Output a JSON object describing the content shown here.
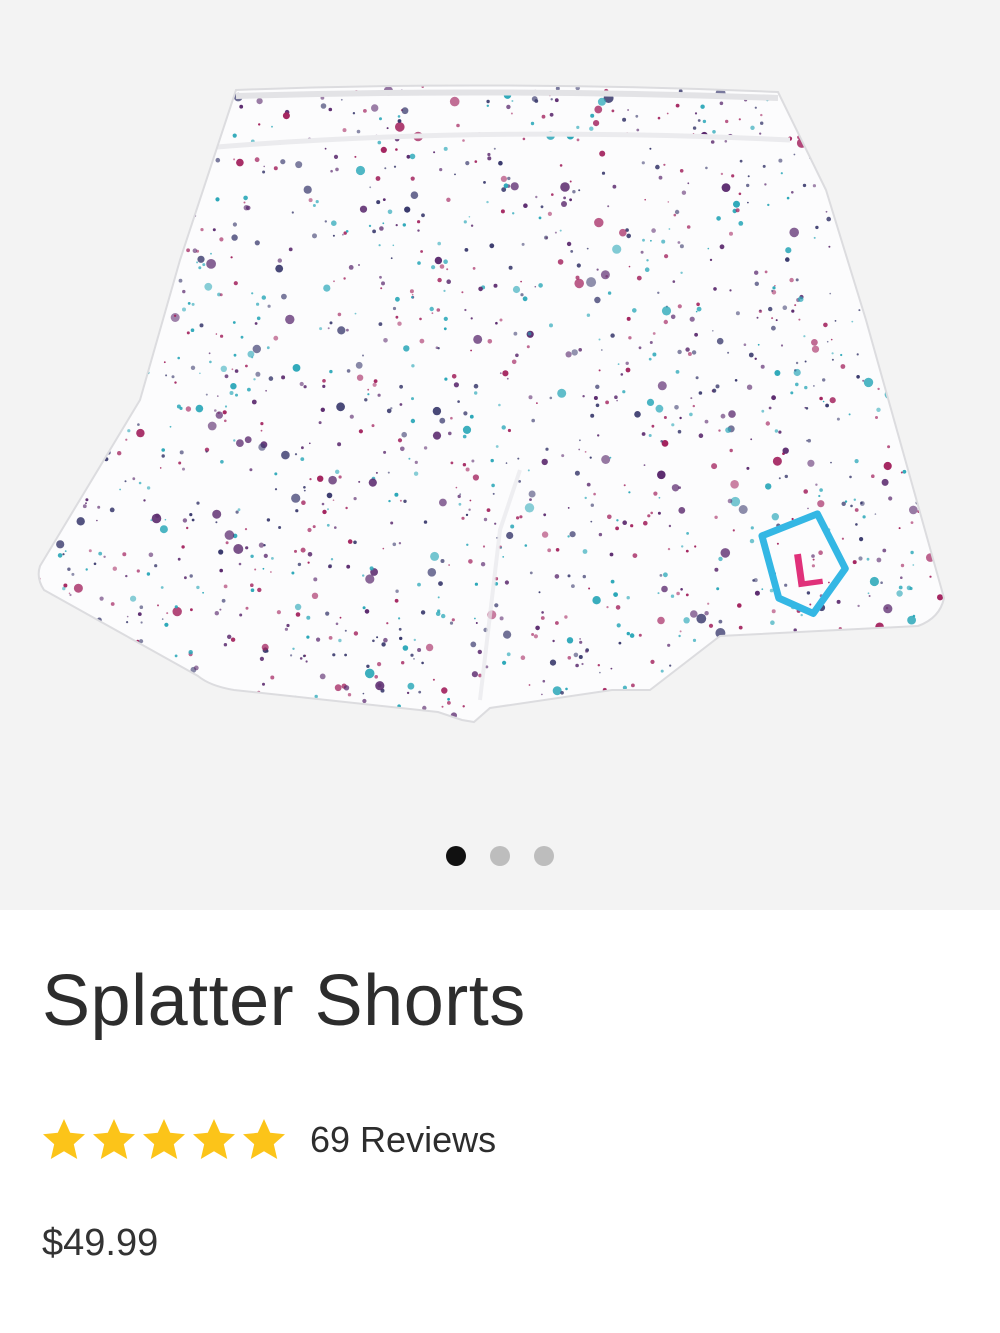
{
  "product": {
    "title": "Splatter Shorts",
    "price": "$49.99",
    "reviews_label": "69 Reviews",
    "rating": {
      "value": 5,
      "max": 5
    }
  },
  "gallery": {
    "image_count": 3,
    "active_index": 0,
    "image_icon": "splatter-shorts-photo",
    "logo_letter": "L"
  },
  "colors": {
    "star": "#fcc419",
    "dot_active": "#111111",
    "dot_inactive": "#bdbdbd",
    "splatter_teal": "#2aa7b8",
    "splatter_purple": "#5b2a6e",
    "splatter_magenta": "#a3245f",
    "logo_blue": "#34b7e4",
    "logo_pink": "#e0317a"
  }
}
